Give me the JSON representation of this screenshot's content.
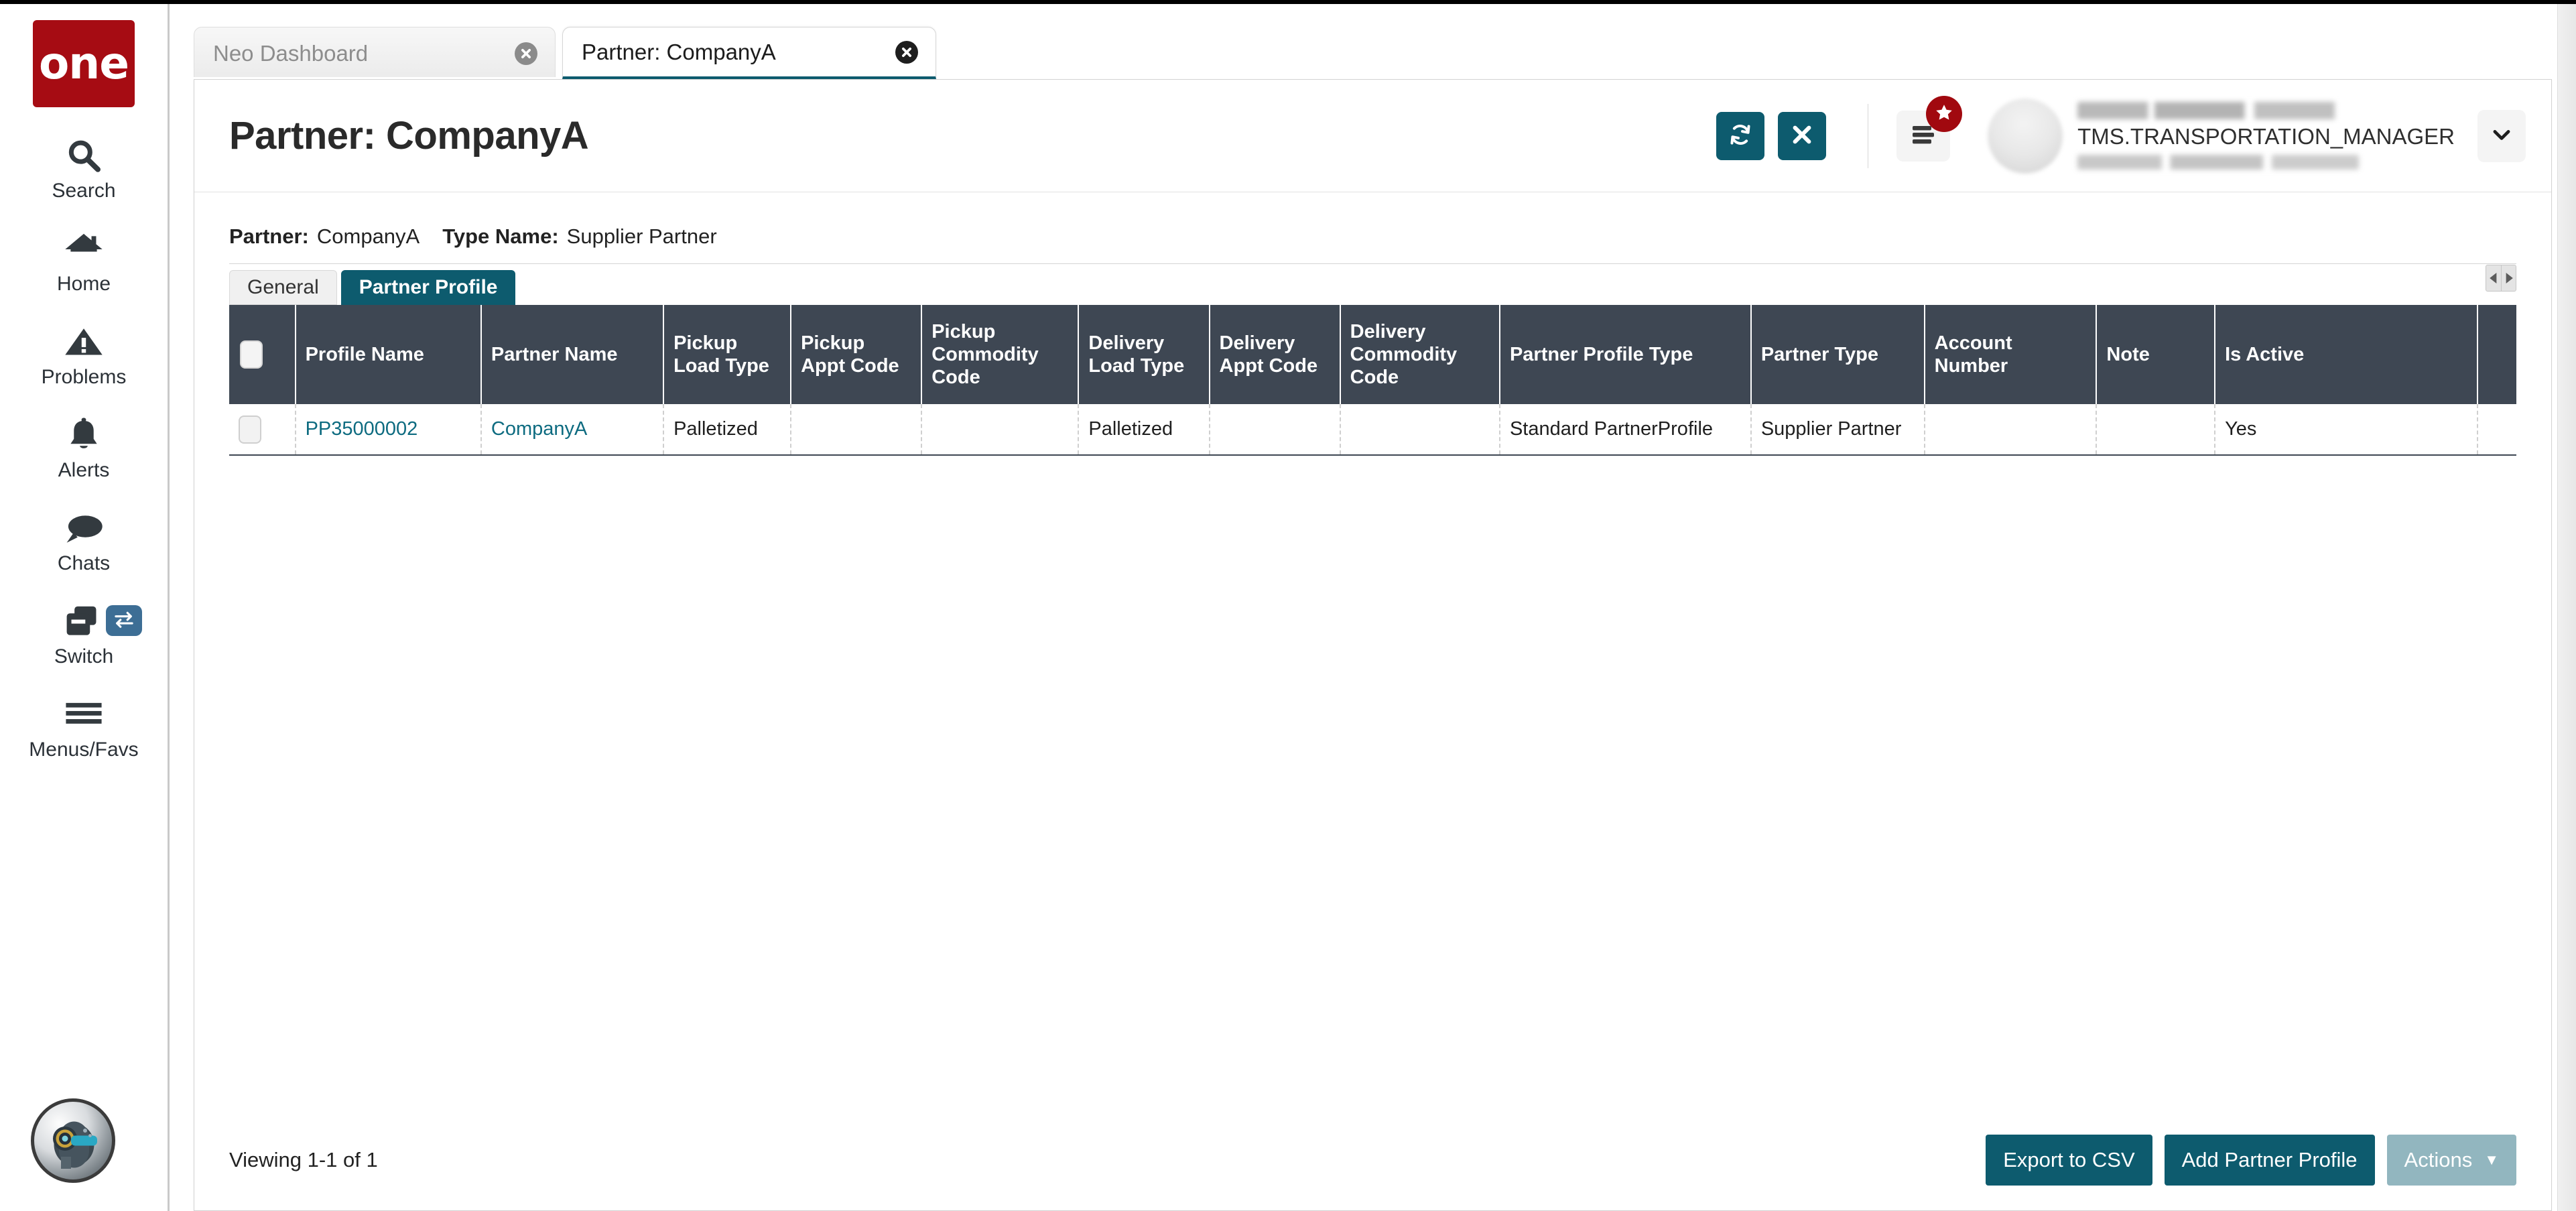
{
  "brand": {
    "logo_text": "one"
  },
  "sidebar": {
    "items": [
      {
        "label": "Search",
        "icon": "search-icon"
      },
      {
        "label": "Home",
        "icon": "home-icon"
      },
      {
        "label": "Problems",
        "icon": "warning-triangle-icon"
      },
      {
        "label": "Alerts",
        "icon": "bell-icon"
      },
      {
        "label": "Chats",
        "icon": "chat-bubble-icon"
      },
      {
        "label": "Switch",
        "icon": "switch-windows-icon",
        "badge_icon": "swap-arrows-icon"
      },
      {
        "label": "Menus/Favs",
        "icon": "hamburger-icon"
      }
    ],
    "assistant_avatar": "robot-assistant-avatar"
  },
  "browser_tabs": [
    {
      "label": "Neo Dashboard",
      "active": false,
      "close_icon": "close-circle-icon"
    },
    {
      "label": "Partner: CompanyA",
      "active": true,
      "close_icon": "close-circle-icon"
    }
  ],
  "header": {
    "title": "Partner: CompanyA",
    "refresh_icon": "refresh-icon",
    "close_icon": "close-x-icon",
    "menu_icon": "list-menu-icon",
    "badge_icon": "star-icon",
    "user": {
      "name": "",
      "role": "TMS.TRANSPORTATION_MANAGER",
      "email": "",
      "avatar": "user-avatar",
      "caret_icon": "chevron-down-icon"
    }
  },
  "partner_meta": {
    "partner_label": "Partner:",
    "partner_value": "CompanyA",
    "type_label": "Type Name:",
    "type_value": "Supplier Partner"
  },
  "inner_tabs": [
    {
      "label": "General",
      "active": false
    },
    {
      "label": "Partner Profile",
      "active": true
    }
  ],
  "tab_scroll": {
    "left_icon": "arrow-left-icon",
    "right_icon": "arrow-right-icon"
  },
  "grid": {
    "columns": [
      "Profile Name",
      "Partner Name",
      "Pickup Load Type",
      "Pickup Appt Code",
      "Pickup Commodity Code",
      "Delivery Load Type",
      "Delivery Appt Code",
      "Delivery Commodity Code",
      "Partner Profile Type",
      "Partner Type",
      "Account Number",
      "Note",
      "Is Active"
    ],
    "rows": [
      {
        "profile_name": "PP35000002",
        "partner_name": "CompanyA",
        "pickup_load_type": "Palletized",
        "pickup_appt_code": "",
        "pickup_commodity_code": "",
        "delivery_load_type": "Palletized",
        "delivery_appt_code": "",
        "delivery_commodity_code": "",
        "partner_profile_type": "Standard PartnerProfile",
        "partner_type": "Supplier Partner",
        "account_number": "",
        "note": "",
        "is_active": "Yes"
      }
    ]
  },
  "footer": {
    "viewing": "Viewing 1-1 of 1",
    "export_label": "Export to CSV",
    "add_label": "Add Partner Profile",
    "actions_label": "Actions",
    "actions_caret": "▼"
  },
  "colors": {
    "brand_red": "#a60c13",
    "teal": "#0d5b6e",
    "teal_disabled": "#92b6bf",
    "grid_header": "#3e4753",
    "link": "#0d6b80",
    "switch_badge_blue": "#3d6e95"
  }
}
